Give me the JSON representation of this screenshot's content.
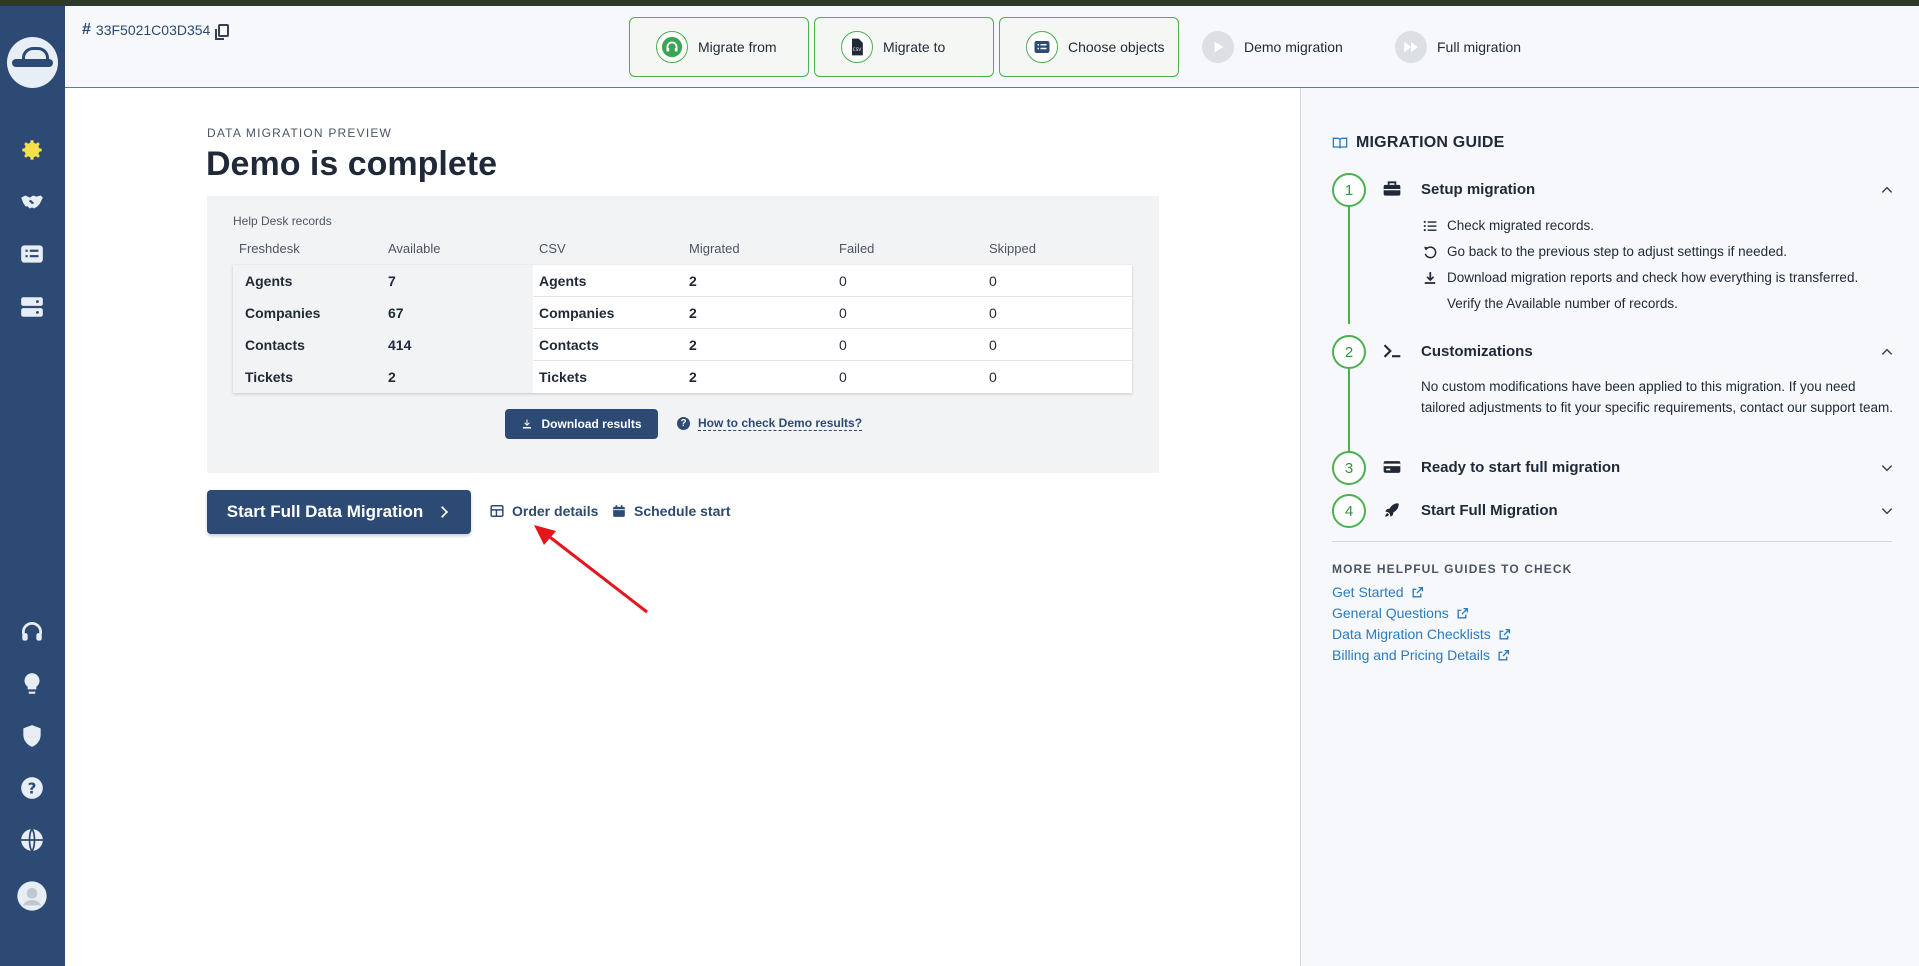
{
  "header": {
    "order_id": "33F5021C03D354",
    "steps": [
      {
        "label": "Migrate from",
        "state": "done"
      },
      {
        "label": "Migrate to",
        "state": "done"
      },
      {
        "label": "Choose objects",
        "state": "done"
      },
      {
        "label": "Demo migration",
        "state": "pending"
      },
      {
        "label": "Full migration",
        "state": "pending"
      }
    ]
  },
  "sidebar": {
    "items": [
      {
        "icon": "gear-icon",
        "color": "#f5e04a"
      },
      {
        "icon": "handshake-icon"
      },
      {
        "icon": "list-icon"
      },
      {
        "icon": "server-icon"
      },
      {
        "icon": "headset-icon"
      },
      {
        "icon": "lightbulb-icon"
      },
      {
        "icon": "shield-icon"
      },
      {
        "icon": "question-icon"
      },
      {
        "icon": "globe-icon"
      },
      {
        "icon": "avatar-icon"
      }
    ]
  },
  "main": {
    "eyebrow": "DATA MIGRATION PREVIEW",
    "title": "Demo is complete",
    "box_caption": "Help Desk records",
    "columns": [
      "Freshdesk",
      "Available",
      "CSV",
      "Migrated",
      "Failed",
      "Skipped"
    ],
    "rows": [
      {
        "source": "Agents",
        "available": "7",
        "target": "Agents",
        "migrated": "2",
        "failed": "0",
        "skipped": "0"
      },
      {
        "source": "Companies",
        "available": "67",
        "target": "Companies",
        "migrated": "2",
        "failed": "0",
        "skipped": "0"
      },
      {
        "source": "Contacts",
        "available": "414",
        "target": "Contacts",
        "migrated": "2",
        "failed": "0",
        "skipped": "0"
      },
      {
        "source": "Tickets",
        "available": "2",
        "target": "Tickets",
        "migrated": "2",
        "failed": "0",
        "skipped": "0"
      }
    ],
    "download_label": "Download results",
    "help_link": "How to check Demo results?",
    "start_label": "Start Full Data Migration",
    "order_details_label": "Order details",
    "schedule_label": "Schedule start"
  },
  "guide": {
    "title": "MIGRATION GUIDE",
    "sections": [
      {
        "num": "1",
        "title": "Setup migration",
        "expanded": true
      },
      {
        "num": "2",
        "title": "Customizations",
        "expanded": true
      },
      {
        "num": "3",
        "title": "Ready to start full migration",
        "expanded": false
      },
      {
        "num": "4",
        "title": "Start Full Migration",
        "expanded": false
      }
    ],
    "setup_items": [
      "Check migrated records.",
      "Go back to the previous step to adjust settings if needed.",
      "Download migration reports and check how everything is transferred.",
      "Verify the Available number of records."
    ],
    "customizations_text": "No custom modifications have been applied to this migration. If you need tailored adjustments to fit your specific requirements, contact our support team.",
    "more_title": "MORE HELPFUL GUIDES TO CHECK",
    "more_links": [
      "Get Started",
      "General Questions",
      "Data Migration Checklists",
      "Billing and Pricing Details"
    ]
  },
  "colors": {
    "primary": "#2c4a73",
    "success": "#4caf50",
    "link": "#2a7bc0",
    "annotation_arrow": "#e8141b"
  }
}
